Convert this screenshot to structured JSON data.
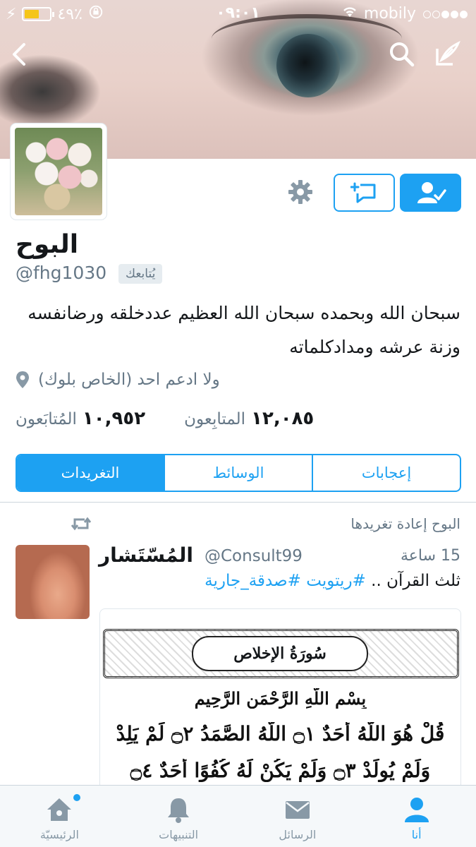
{
  "status_bar": {
    "battery_percent": "٤٩٪",
    "time": "٠٩:٠١",
    "carrier": "mobily",
    "signal_dots": [
      false,
      false,
      true,
      true,
      true
    ]
  },
  "profile": {
    "name": "البوح",
    "handle": "@fhg1030",
    "follows_you_label": "يُتابعك",
    "bio": "سبحان الله وبحمده سبحان الله العظيم عددخلقه ورضانفسه وزنة عرشه ومدادكلماته",
    "location": "(الخاص بلوك)  ولا ادعم احد",
    "following_count": "١٠,٩٥٢",
    "following_label": "المُتابَعون",
    "followers_count": "١٢,٠٨٥",
    "followers_label": "المتابِعون"
  },
  "tabs": [
    {
      "label": "التغريدات",
      "active": true
    },
    {
      "label": "الوسائط",
      "active": false
    },
    {
      "label": "إعجابات",
      "active": false
    }
  ],
  "tweet": {
    "retweet_label": "البوح إعادة تغريدها",
    "author_name": "المُسّتَشار",
    "author_handle": "@Consult99",
    "time": "15 ساعة",
    "text_plain": "ثلث القرآن .. ",
    "hashtags": "#ريتويت #صدقة_جارية",
    "media": {
      "surah_title": "سُورَةُ الإخلاص",
      "basmala": "بِسْمِ اللَّهِ الرَّحْمَنِ الرَّحِيمِ",
      "verse_line_1": "قُلْ هُوَ اللَّهُ أَحَدٌ ۝١ اللَّهُ الصَّمَدُ ۝٢ لَمْ يَلِدْ",
      "verse_line_2": "وَلَمْ يُولَدْ ۝٣ وَلَمْ يَكُنْ لَهُ كُفُوًا أَحَدٌ ۝٤"
    }
  },
  "tabbar": [
    {
      "label": "الرئيسيّة",
      "icon": "home-icon",
      "active": false,
      "has_dot": true
    },
    {
      "label": "التنبيهات",
      "icon": "bell-icon",
      "active": false
    },
    {
      "label": "الرسائل",
      "icon": "envelope-icon",
      "active": false
    },
    {
      "label": "أنا",
      "icon": "person-icon",
      "active": true
    }
  ],
  "colors": {
    "accent": "#1da1f2",
    "muted": "#657786",
    "icon_gray": "#8899a6",
    "battery": "#f5c518"
  }
}
